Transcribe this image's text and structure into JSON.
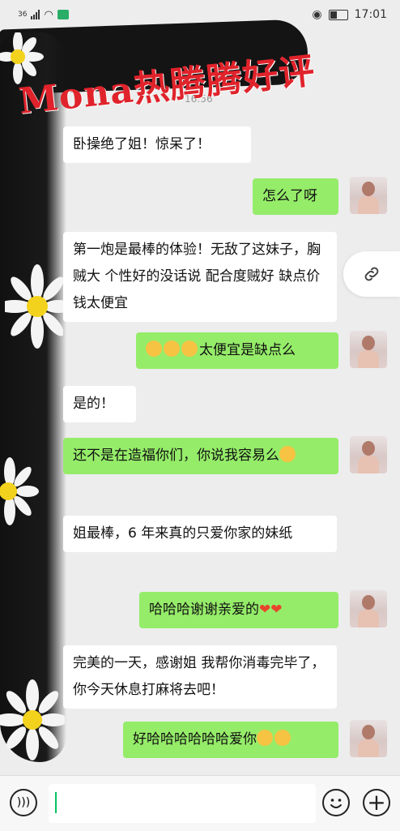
{
  "status_bar": {
    "network": "36",
    "time": "17:01"
  },
  "overlay_title": "Mona热腾腾好评",
  "timestamp": "16:56",
  "messages": [
    {
      "side": "in",
      "text": "卧操绝了姐！惊呆了！"
    },
    {
      "side": "out",
      "text": "怎么了呀"
    },
    {
      "side": "in",
      "text": "第一炮是最棒的体验！无敌了这妹子，胸贼大 个性好的没话说 配合度贼好 缺点价钱太便宜"
    },
    {
      "side": "out",
      "text": "太便宜是缺点么"
    },
    {
      "side": "in",
      "text": "是的！"
    },
    {
      "side": "out",
      "text": "还不是在造福你们，你说我容易么"
    },
    {
      "side": "in",
      "text": "姐最棒，6 年来真的只爱你家的妹纸"
    },
    {
      "side": "out",
      "text": "哈哈哈谢谢亲爱的"
    },
    {
      "side": "in",
      "text": "完美的一天，感谢姐 我帮你消毒完毕了，你今天休息打麻将去吧！"
    },
    {
      "side": "out",
      "text": "好哈哈哈哈哈哈爱你"
    }
  ],
  "icons": {
    "link": "link-icon",
    "voice": "voice-icon",
    "emoji": "emoji-icon",
    "plus": "plus-icon"
  },
  "colors": {
    "out_bubble": "#95ec69",
    "in_bubble": "#ffffff",
    "title": "#e0232b"
  }
}
